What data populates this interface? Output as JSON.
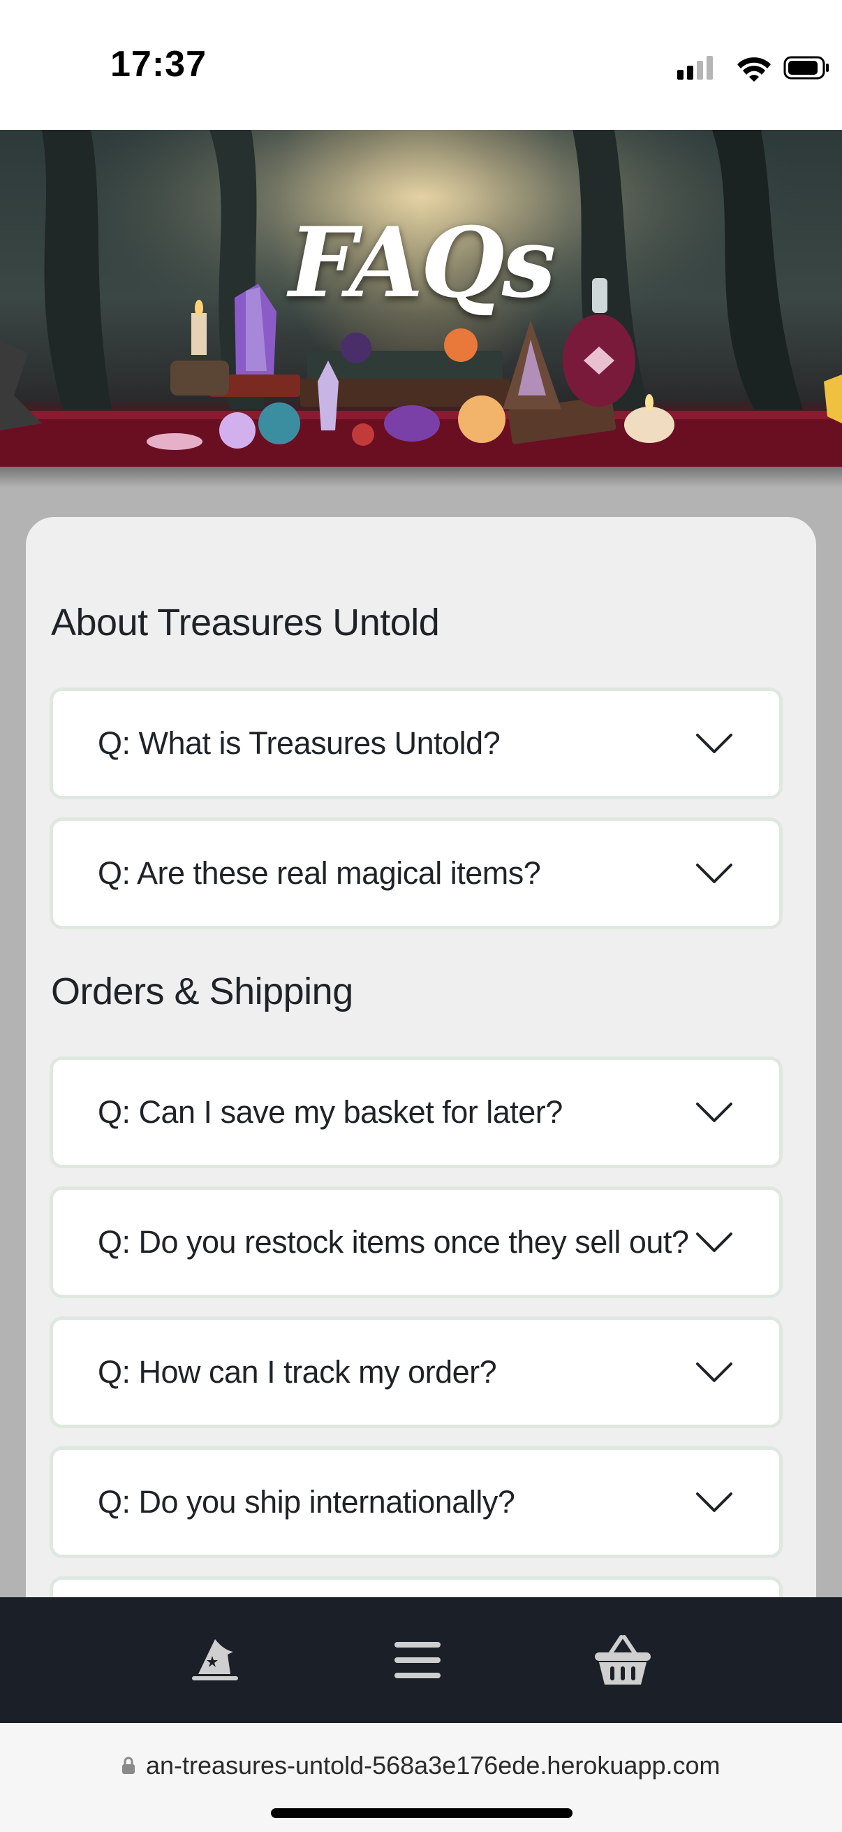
{
  "status_bar": {
    "time": "17:37"
  },
  "hero": {
    "title": "FAQs"
  },
  "sections": [
    {
      "heading": "About Treasures Untold",
      "questions": [
        "Q: What is Treasures Untold?",
        "Q: Are these real magical items?"
      ]
    },
    {
      "heading": "Orders & Shipping",
      "questions": [
        "Q: Can I save my basket for later?",
        "Q: Do you restock items once they sell out?",
        "Q: How can I track my order?",
        "Q: Do you ship internationally?"
      ]
    }
  ],
  "bottom_nav": {
    "items": [
      {
        "icon": "wizard-hat-icon"
      },
      {
        "icon": "menu-icon"
      },
      {
        "icon": "basket-icon"
      }
    ]
  },
  "url_bar": {
    "url": "an-treasures-untold-568a3e176ede.herokuapp.com"
  },
  "colors": {
    "nav_bg": "#1b2028",
    "card_bg": "#efefef",
    "item_border": "#dfe8e0",
    "text": "#1f2328"
  }
}
